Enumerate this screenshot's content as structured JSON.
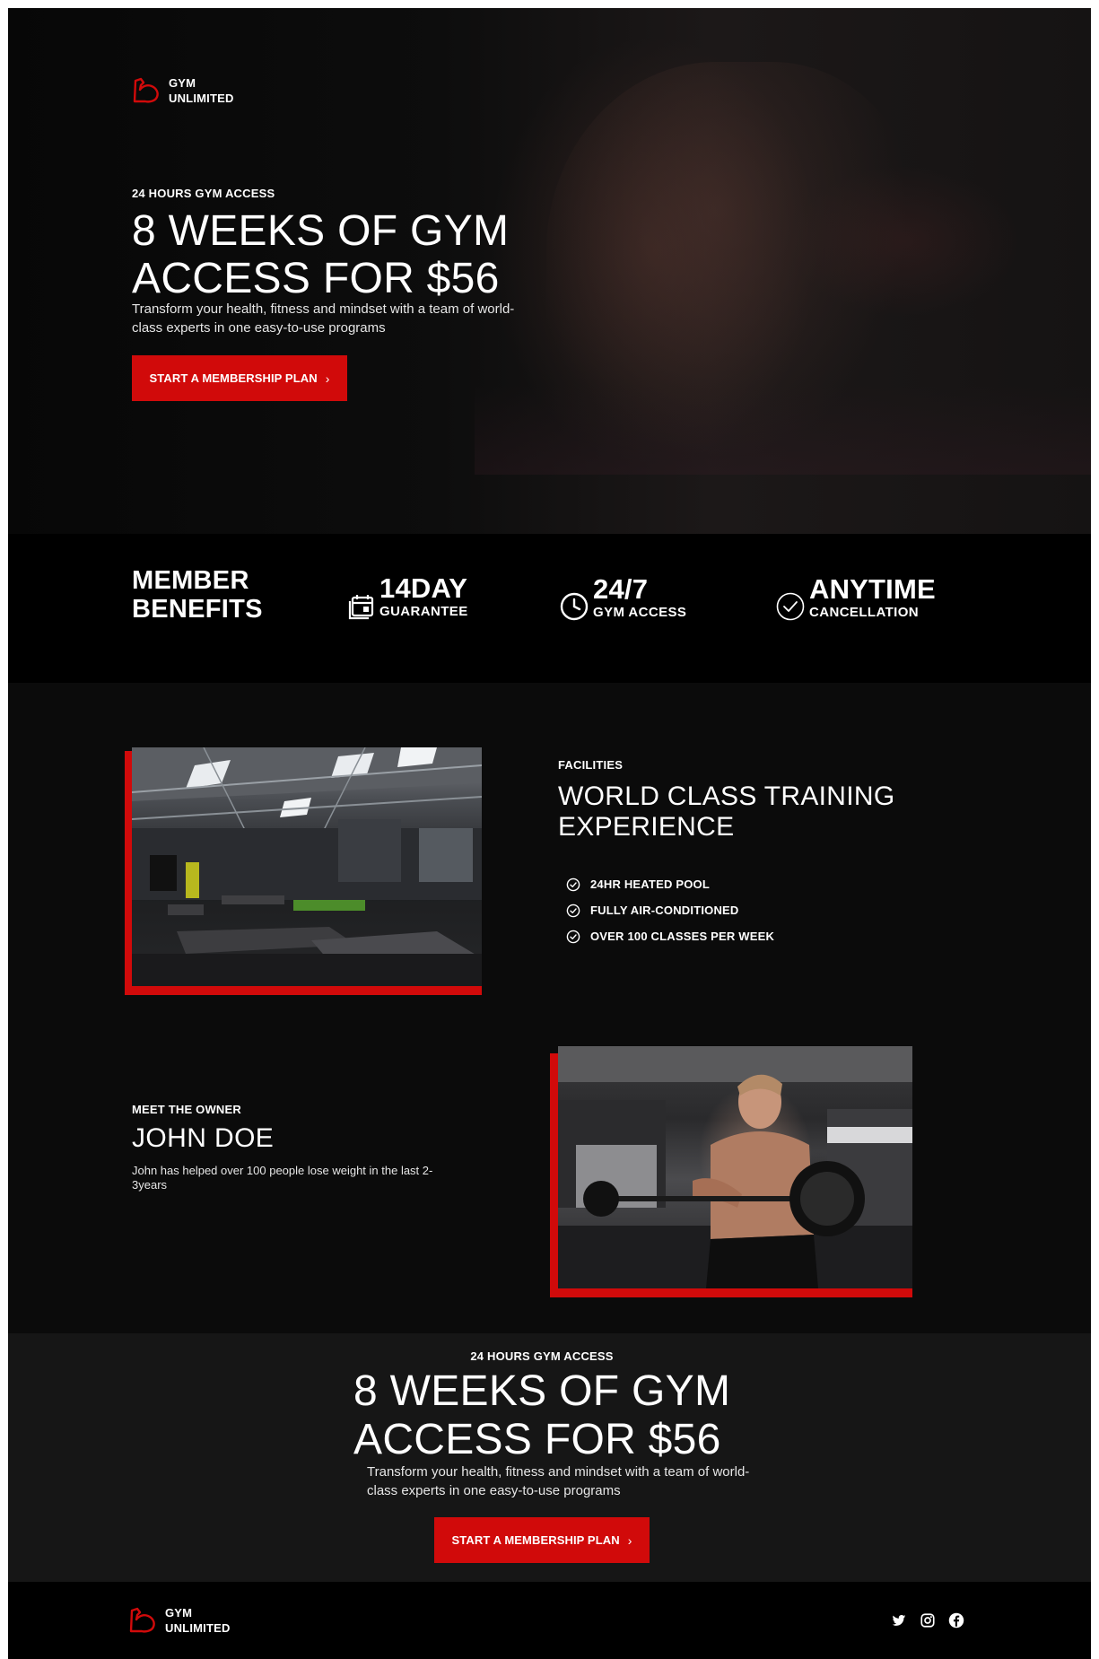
{
  "brand": {
    "name_line1": "GYM",
    "name_line2": "UNLIMITED",
    "accent_color": "#d10a0a",
    "logo_icon": "flexed-arm-icon"
  },
  "hero": {
    "eyebrow": "24 HOURS GYM ACCESS",
    "title_line1": "8 WEEKS OF GYM",
    "title_line2": "ACCESS FOR $56",
    "subtitle": "Transform your health, fitness and mindset with a team of world-class experts in one easy-to-use programs",
    "cta_label": "START A MEMBERSHIP PLAN",
    "background_image": "woman-exercising-photo"
  },
  "benefits": {
    "title_line1": "MEMBER",
    "title_line2": "BENEFITS",
    "items": [
      {
        "icon": "calendar-icon",
        "big": "14DAY",
        "small": "GUARANTEE"
      },
      {
        "icon": "clock-icon",
        "big": "24/7",
        "small": "GYM ACCESS"
      },
      {
        "icon": "check-circle-icon",
        "big": "ANYTIME",
        "small": "CANCELLATION"
      }
    ]
  },
  "facilities": {
    "eyebrow": "FACILITIES",
    "title_line1": "WORLD CLASS TRAINING",
    "title_line2": "EXPERIENCE",
    "items": [
      "24HR HEATED POOL",
      "FULLY AIR-CONDITIONED",
      "OVER 100 CLASSES PER WEEK"
    ],
    "image": "gym-interior-photo"
  },
  "owner": {
    "eyebrow": "MEET THE OWNER",
    "name": "JOHN DOE",
    "bio": "John has helped over 100 people lose weight in the last 2-3years",
    "image": "man-lifting-barbell-photo"
  },
  "cta_section": {
    "eyebrow": "24 HOURS GYM ACCESS",
    "title_line1": "8 WEEKS OF GYM",
    "title_line2": "ACCESS FOR $56",
    "subtitle": "Transform your health, fitness and mindset with a team of world-class experts in one easy-to-use programs",
    "cta_label": "START A MEMBERSHIP PLAN"
  },
  "footer": {
    "social": [
      "twitter-icon",
      "instagram-icon",
      "facebook-icon"
    ]
  }
}
